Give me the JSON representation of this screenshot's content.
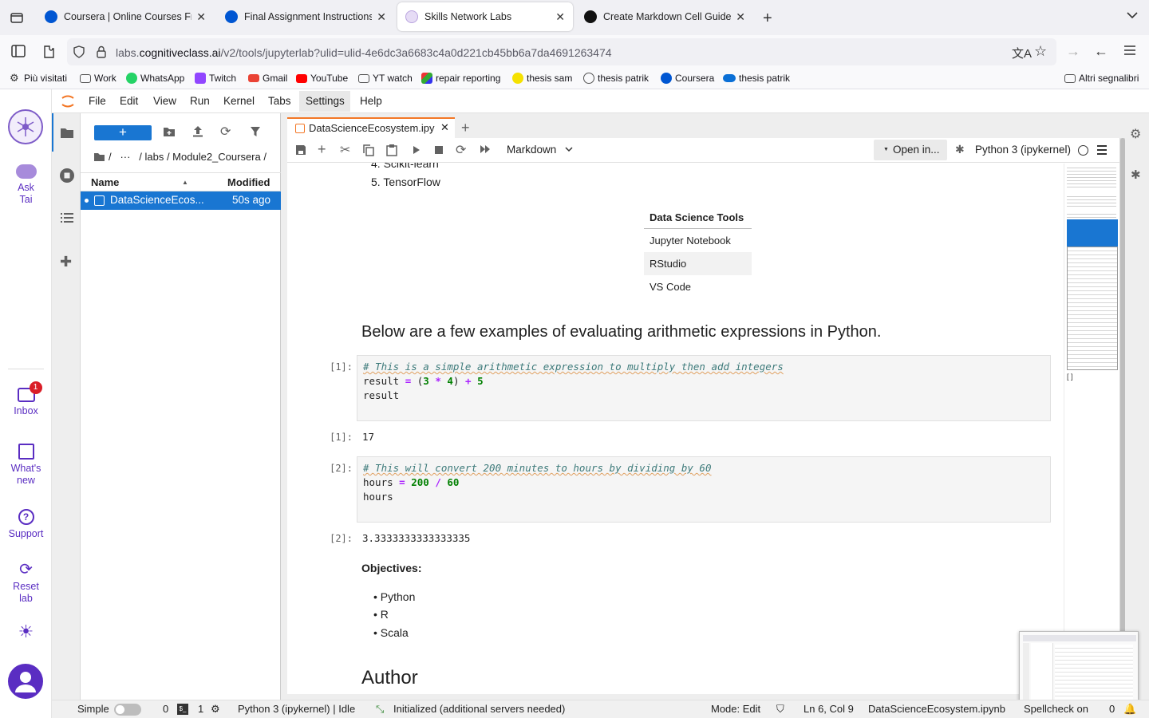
{
  "browser": {
    "tabs": [
      {
        "title": "Coursera | Online Courses From",
        "icon": "coursera-icon",
        "color": "#0056d2"
      },
      {
        "title": "Final Assignment Instructions: C",
        "icon": "coursera-icon",
        "color": "#0056d2"
      },
      {
        "title": "Skills Network Labs",
        "icon": "skills-network-icon",
        "color": "#c7b3e6"
      },
      {
        "title": "Create Markdown Cell Guide",
        "icon": "chatgpt-icon",
        "color": "#000000"
      }
    ],
    "url_domain_prefix": "labs.",
    "url_domain": "cognitiveclass.ai",
    "url_path": "/v2/tools/jupyterlab?ulid=ulid-4e6dc3a6683c4a0d221cb45bb6a7da4691263474",
    "bookmarks": [
      {
        "label": "Più visitati",
        "icon": "gear-icon"
      },
      {
        "label": "Work",
        "icon": "folder-icon"
      },
      {
        "label": "WhatsApp",
        "icon": "whatsapp-icon"
      },
      {
        "label": "Twitch",
        "icon": "twitch-icon"
      },
      {
        "label": "Gmail",
        "icon": "gmail-icon"
      },
      {
        "label": "YouTube",
        "icon": "youtube-icon"
      },
      {
        "label": "YT watch",
        "icon": "folder-icon"
      },
      {
        "label": "repair reporting",
        "icon": "app-icon"
      },
      {
        "label": "thesis sam",
        "icon": "smiley-icon"
      },
      {
        "label": "thesis patrik",
        "icon": "globe-icon"
      },
      {
        "label": "Coursera",
        "icon": "coursera-icon"
      },
      {
        "label": "thesis patrik",
        "icon": "cloud-icon"
      }
    ],
    "other_bookmarks": "Altri segnalibri"
  },
  "rail": {
    "ask": "Ask\nTai",
    "inbox": "Inbox",
    "inbox_badge": "1",
    "whats_new": "What's\nnew",
    "support": "Support",
    "reset": "Reset\nlab"
  },
  "menu": [
    "File",
    "Edit",
    "View",
    "Run",
    "Kernel",
    "Tabs",
    "Settings",
    "Help"
  ],
  "filebrowser": {
    "breadcrumb": "/   ···   / labs / Module2_Coursera /",
    "col_name": "Name",
    "col_modified": "Modified",
    "files": [
      {
        "name": "DataScienceEcos...",
        "modified": "50s ago"
      }
    ]
  },
  "notebook": {
    "tab_title": "DataScienceEcosystem.ipy",
    "cell_type": "Markdown",
    "open_in": "Open in...",
    "kernel": "Python 3 (ipykernel)",
    "list_items_top": [
      "4. Scikit-learn",
      "5. TensorFlow"
    ],
    "table_header": "Data Science Tools",
    "table_rows": [
      "Jupyter Notebook",
      "RStudio",
      "VS Code"
    ],
    "heading_examples": "Below are a few examples of evaluating arithmetic expressions in Python.",
    "cell1_prompt": "[1]:",
    "cell1_comment": "# This is a simple arithmetic expression to multiply then add integers",
    "cell1_line2_a": "result ",
    "cell1_line2_eq": "=",
    "cell1_line2_b": " (",
    "cell1_n1": "3",
    "cell1_op1": "*",
    "cell1_n2": "4",
    "cell1_line2_c": ") ",
    "cell1_op2": "+",
    "cell1_n3": "5",
    "cell1_line3": "result",
    "out1_prompt": "[1]:",
    "out1": "17",
    "cell2_prompt": "[2]:",
    "cell2_comment": "# This will convert 200 minutes to hours by dividing by 60",
    "cell2_line2_a": "hours ",
    "cell2_eq": "=",
    "cell2_n1": "200",
    "cell2_op": "/",
    "cell2_n2": "60",
    "cell2_line3": "hours",
    "out2_prompt": "[2]:",
    "out2": "3.3333333333333335",
    "objectives_label": "Objectives:",
    "objectives": [
      "Python",
      "R",
      "Scala"
    ],
    "author_heading": "Author"
  },
  "statusbar": {
    "mode_label": "Simple",
    "terminals": "0",
    "kernels": "1",
    "kernel_status": "Python 3 (ipykernel) | Idle",
    "lsp": "Initialized (additional servers needed)",
    "mode": "Mode: Edit",
    "position": "Ln 6, Col 9",
    "filename": "DataScienceEcosystem.ipynb",
    "spellcheck": "Spellcheck on",
    "notif": "0"
  },
  "colors": {
    "accent": "#1976d2",
    "jupyter_orange": "#f37726",
    "rail_purple": "#5a2dc2"
  }
}
